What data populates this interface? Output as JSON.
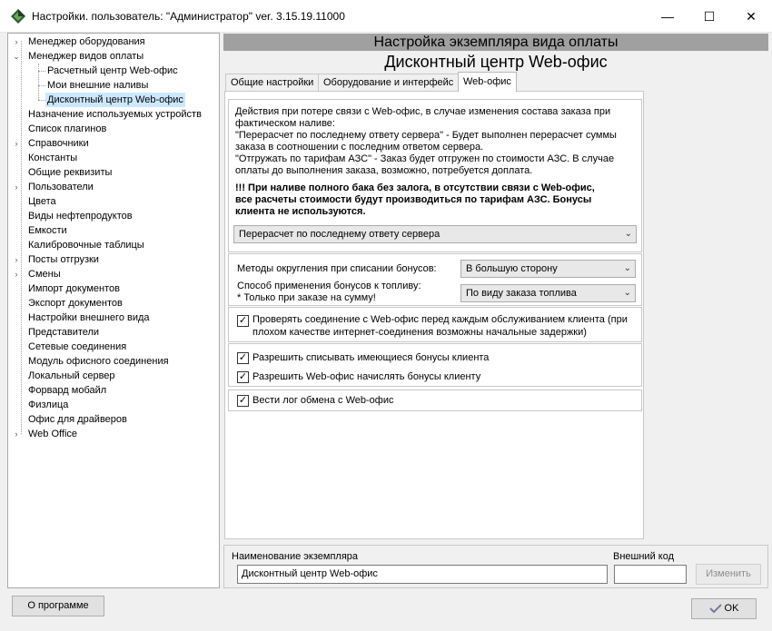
{
  "window": {
    "title": "Настройки. пользователь: \"Администратор\" ver. 3.15.19.11000",
    "min_glyph": "—",
    "max_glyph": "☐",
    "close_glyph": "✕"
  },
  "tree": {
    "items": [
      {
        "label": "Менеджер оборудования",
        "expander": "›"
      },
      {
        "label": "Менеджер видов оплаты",
        "expander": "⌄"
      },
      {
        "label": "Расчетный центр Web-офис"
      },
      {
        "label": "Мои внешние наливы"
      },
      {
        "label": "Дисконтный центр Web-офис",
        "selected": true
      },
      {
        "label": "Назначение используемых устройств"
      },
      {
        "label": "Список плагинов"
      },
      {
        "label": "Справочники",
        "expander": "›"
      },
      {
        "label": "Константы"
      },
      {
        "label": "Общие реквизиты"
      },
      {
        "label": "Пользователи",
        "expander": "›"
      },
      {
        "label": "Цвета"
      },
      {
        "label": "Виды нефтепродуктов"
      },
      {
        "label": "Емкости"
      },
      {
        "label": "Калибровочные таблицы"
      },
      {
        "label": "Посты отгрузки",
        "expander": "›"
      },
      {
        "label": "Смены",
        "expander": "›"
      },
      {
        "label": "Импорт документов"
      },
      {
        "label": "Экспорт документов"
      },
      {
        "label": "Настройки внешнего вида"
      },
      {
        "label": "Представители"
      },
      {
        "label": "Сетевые соединения"
      },
      {
        "label": "Модуль офисного соединения"
      },
      {
        "label": "Локальный сервер"
      },
      {
        "label": "Форвард мобайл"
      },
      {
        "label": "Физлица"
      },
      {
        "label": "Офис для драйверов"
      },
      {
        "label": "Web Office",
        "expander": "›"
      }
    ]
  },
  "header": {
    "title": "Настройка экземпляра вида оплаты",
    "subtitle": "Дисконтный центр Web-офис"
  },
  "tabs": [
    {
      "label": "Общие настройки"
    },
    {
      "label": "Оборудование и интерфейс"
    },
    {
      "label": "Web-офис",
      "active": true
    }
  ],
  "web_office": {
    "desc_lines": [
      "Действия при потере связи с Web-офис, в случае изменения состава заказа при",
      "фактическом наливе:",
      "\"Перерасчет по последнему ответу сервера\" - Будет выполнен перерасчет суммы",
      "заказа в соотношении с последним ответом сервера.",
      "\"Отгружать по тарифам АЗС\" - Заказ будет отгружен по стоимости АЗС. В случае",
      "оплаты до выполнения заказа, возможно, потребуется доплата."
    ],
    "warning_lines": [
      "!!! При наливе полного бака без залога, в отсутствии связи с Web-офис,",
      "все расчеты стоимости будут производиться по тарифам АЗС. Бонусы",
      "клиента не используются."
    ],
    "connection_loss_value": "Перерасчет по последнему ответу сервера",
    "rounding_label": "Методы округления при списании бонусов:",
    "rounding_value": "В большую сторону",
    "bonus_method_label_1": "Способ применения бонусов к топливу:",
    "bonus_method_label_2": "* Только при заказе на сумму!",
    "bonus_method_value": "По виду заказа топлива",
    "check_connection_line1": "Проверять соединение с Web-офис перед каждым обслуживанием клиента (при",
    "check_connection_line2": "плохом качестве интернет-соединения возможны начальные задержки)",
    "allow_writeoff": "Разрешить списывать имеющиеся бонусы клиента",
    "allow_accrual": "Разрешить Web-офис начислять бонусы клиенту",
    "log_exchange": "Вести лог обмена с Web-офис",
    "check_mark": "✓",
    "dropdown_glyph": "⌄"
  },
  "instance": {
    "name_label": "Наименование экземпляра",
    "name_value": "Дисконтный центр Web-офис",
    "ext_code_label": "Внешний код",
    "ext_code_value": "",
    "change_button": "Изменить"
  },
  "footer": {
    "about_button": "О программе",
    "ok_button": "OK"
  }
}
